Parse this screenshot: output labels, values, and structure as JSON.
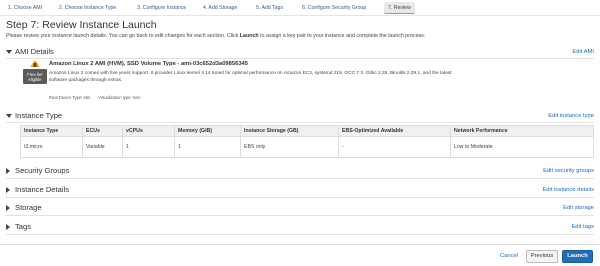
{
  "wizard": {
    "steps": [
      {
        "label": "1. Choose AMI"
      },
      {
        "label": "2. Choose Instance Type"
      },
      {
        "label": "3. Configure Instance"
      },
      {
        "label": "4. Add Storage"
      },
      {
        "label": "5. Add Tags"
      },
      {
        "label": "6. Configure Security Group"
      },
      {
        "label": "7. Review"
      }
    ]
  },
  "page": {
    "title": "Step 7: Review Instance Launch",
    "intro_before": "Please review your instance launch details. You can go back to edit changes for each section. Click ",
    "intro_bold": "Launch",
    "intro_after": " to assign a key pair to your instance and complete the launch process."
  },
  "ami": {
    "section_title": "AMI Details",
    "edit_label": "Edit AMI",
    "badge": "Free tier eligible",
    "name": "Amazon Linux 2 AMI (HVM), SSD Volume Type - ami-03c652d3a09856345",
    "description": "Amazon Linux 2 comes with five years support. It provides Linux kernel 4.14 tuned for optimal performance on Amazon EC2, systemd 219, GCC 7.3, Glibc 2.26, Binutils 2.29.1, and the latest software packages through extras.",
    "root_device": "Root Device Type: ebs",
    "virtualization": "Virtualization type: hvm"
  },
  "instance_type": {
    "section_title": "Instance Type",
    "edit_label": "Edit instance type",
    "columns": [
      "Instance Type",
      "ECUs",
      "vCPUs",
      "Memory (GiB)",
      "Instance Storage (GB)",
      "EBS-Optimized Available",
      "Network Performance"
    ],
    "rows": [
      [
        "t2.micro",
        "Variable",
        "1",
        "1",
        "EBS only",
        "-",
        "Low to Moderate"
      ]
    ]
  },
  "sections": {
    "security_groups": {
      "title": "Security Groups",
      "edit_label": "Edit security groups"
    },
    "instance_details": {
      "title": "Instance Details",
      "edit_label": "Edit instance details"
    },
    "storage": {
      "title": "Storage",
      "edit_label": "Edit storage"
    },
    "tags": {
      "title": "Tags",
      "edit_label": "Edit tags"
    }
  },
  "footer": {
    "cancel_label": "Cancel",
    "previous_label": "Previous",
    "launch_label": "Launch"
  }
}
